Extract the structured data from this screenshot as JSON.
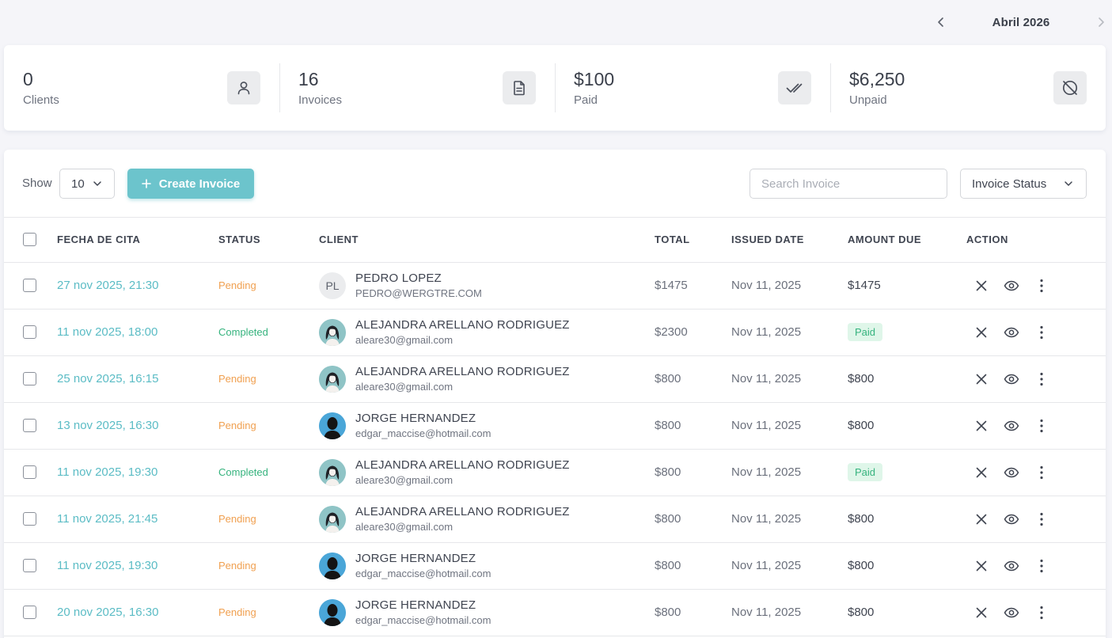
{
  "month_nav": {
    "label": "Abril 2026"
  },
  "stats": [
    {
      "value": "0",
      "label": "Clients",
      "icon": "user-icon"
    },
    {
      "value": "16",
      "label": "Invoices",
      "icon": "document-icon"
    },
    {
      "value": "$100",
      "label": "Paid",
      "icon": "double-check-icon"
    },
    {
      "value": "$6,250",
      "label": "Unpaid",
      "icon": "ban-circle-icon"
    }
  ],
  "toolbar": {
    "show_label": "Show",
    "page_size": "10",
    "create_label": "Create Invoice",
    "search_placeholder": "Search Invoice",
    "status_select": "Invoice Status"
  },
  "table": {
    "headers": [
      "FECHA DE CITA",
      "STATUS",
      "CLIENT",
      "TOTAL",
      "ISSUED DATE",
      "AMOUNT DUE",
      "ACTION"
    ],
    "rows": [
      {
        "date": "27 nov 2025, 21:30",
        "status": "Pending",
        "client_name": "PEDRO LOPEZ",
        "client_email": "PEDRO@WERGTRE.COM",
        "avatar": "PL",
        "total": "$1475",
        "issued": "Nov 11, 2025",
        "due": "$1475"
      },
      {
        "date": "11 nov 2025, 18:00",
        "status": "Completed",
        "client_name": "ALEJANDRA ARELLANO RODRIGUEZ",
        "client_email": "aleare30@gmail.com",
        "avatar": "",
        "total": "$2300",
        "issued": "Nov 11, 2025",
        "due": "Paid"
      },
      {
        "date": "25 nov 2025, 16:15",
        "status": "Pending",
        "client_name": "ALEJANDRA ARELLANO RODRIGUEZ",
        "client_email": "aleare30@gmail.com",
        "avatar": "",
        "total": "$800",
        "issued": "Nov 11, 2025",
        "due": "$800"
      },
      {
        "date": "13 nov 2025, 16:30",
        "status": "Pending",
        "client_name": "JORGE HERNANDEZ",
        "client_email": "edgar_maccise@hotmail.com",
        "avatar": "",
        "total": "$800",
        "issued": "Nov 11, 2025",
        "due": "$800"
      },
      {
        "date": "11 nov 2025, 19:30",
        "status": "Completed",
        "client_name": "ALEJANDRA ARELLANO RODRIGUEZ",
        "client_email": "aleare30@gmail.com",
        "avatar": "",
        "total": "$800",
        "issued": "Nov 11, 2025",
        "due": "Paid"
      },
      {
        "date": "11 nov 2025, 21:45",
        "status": "Pending",
        "client_name": "ALEJANDRA ARELLANO RODRIGUEZ",
        "client_email": "aleare30@gmail.com",
        "avatar": "",
        "total": "$800",
        "issued": "Nov 11, 2025",
        "due": "$800"
      },
      {
        "date": "11 nov 2025, 19:30",
        "status": "Pending",
        "client_name": "JORGE HERNANDEZ",
        "client_email": "edgar_maccise@hotmail.com",
        "avatar": "",
        "total": "$800",
        "issued": "Nov 11, 2025",
        "due": "$800"
      },
      {
        "date": "20 nov 2025, 16:30",
        "status": "Pending",
        "client_name": "JORGE HERNANDEZ",
        "client_email": "edgar_maccise@hotmail.com",
        "avatar": "",
        "total": "$800",
        "issued": "Nov 11, 2025",
        "due": "$800"
      }
    ]
  },
  "colors": {
    "accent": "#6cc4cc",
    "date_link": "#5bbcc5",
    "pending": "#f0a050",
    "completed": "#36b37e",
    "paid_badge_bg": "#dff6e9"
  }
}
